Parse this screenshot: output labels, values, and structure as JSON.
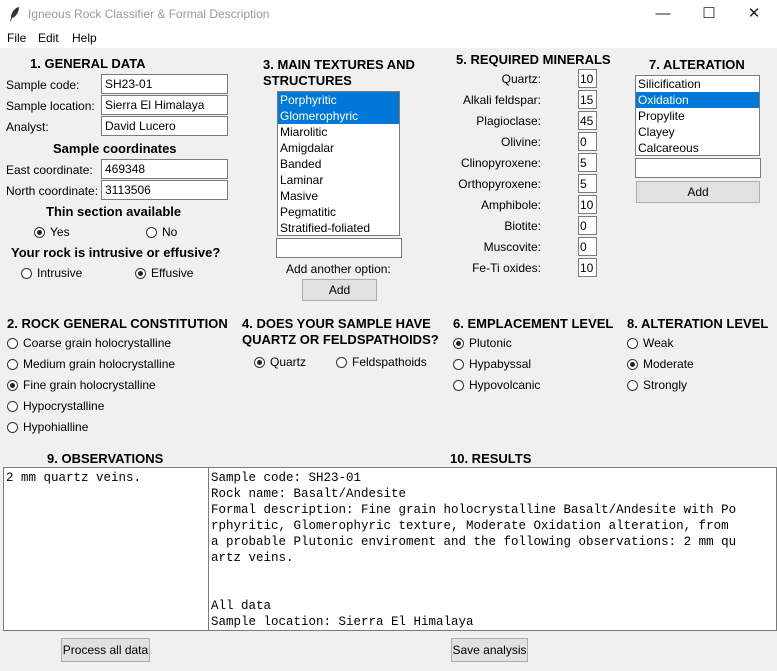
{
  "window": {
    "title": "Igneous Rock Classifier & Formal Description",
    "minimize": "—",
    "maximize": "☐",
    "close": "✕"
  },
  "menu": [
    "File",
    "Edit",
    "Help"
  ],
  "general": {
    "heading": "1. GENERAL DATA",
    "sample_code_label": "Sample code:",
    "sample_code": "SH23-01",
    "sample_location_label": "Sample location:",
    "sample_location": "Sierra El Himalaya",
    "analyst_label": "Analyst:",
    "analyst": "David Lucero",
    "coords_heading": "Sample coordinates",
    "east_label": "East coordinate:",
    "east": "469348",
    "north_label": "North coordinate:",
    "north": "3113506",
    "thin_heading": "Thin section available",
    "yes": "Yes",
    "no": "No",
    "thin_selected": "Yes",
    "intrusive_heading": "Your rock is intrusive or effusive?",
    "intrusive": "Intrusive",
    "effusive": "Effusive",
    "intrusive_selected": "Effusive"
  },
  "textures": {
    "heading_1": "3. MAIN TEXTURES AND",
    "heading_2": "STRUCTURES",
    "items": [
      "Porphyritic",
      "Glomerophyric",
      "Miarolitic",
      "Amigdalar",
      "Banded",
      "Laminar",
      "Masive",
      "Pegmatitic",
      "Stratified-foliated"
    ],
    "selected": [
      0,
      1
    ],
    "new_option": "",
    "add_another_label": "Add another option:",
    "add_button": "Add"
  },
  "minerals": {
    "heading": "5. REQUIRED MINERALS",
    "items": [
      {
        "name": "Quartz:",
        "value": "10"
      },
      {
        "name": "Alkali feldspar:",
        "value": "15"
      },
      {
        "name": "Plagioclase:",
        "value": "45"
      },
      {
        "name": "Olivine:",
        "value": "0"
      },
      {
        "name": "Clinopyroxene:",
        "value": "5"
      },
      {
        "name": "Orthopyroxene:",
        "value": "5"
      },
      {
        "name": "Amphibole:",
        "value": "10"
      },
      {
        "name": "Biotite:",
        "value": "0"
      },
      {
        "name": "Muscovite:",
        "value": "0"
      },
      {
        "name": "Fe-Ti oxides:",
        "value": "10"
      }
    ]
  },
  "alteration": {
    "heading": "7. ALTERATION",
    "items": [
      "Silicification",
      "Oxidation",
      "Propylite",
      "Clayey",
      "Calcareous"
    ],
    "selected": [
      1
    ],
    "new_option": "",
    "add_button": "Add"
  },
  "constitution": {
    "heading": "2. ROCK GENERAL CONSTITUTION",
    "options": [
      "Coarse grain holocrystalline",
      "Medium grain holocrystalline",
      "Fine grain holocrystalline",
      "Hypocrystalline",
      "Hypohialline"
    ],
    "selected": 2
  },
  "quartz_feld": {
    "heading_1": "4. DOES YOUR SAMPLE HAVE",
    "heading_2": "QUARTZ OR FELDSPATHOIDS?",
    "options": [
      "Quartz",
      "Feldspathoids"
    ],
    "selected": 0
  },
  "emplacement": {
    "heading": "6. EMPLACEMENT LEVEL",
    "options": [
      "Plutonic",
      "Hypabyssal",
      "Hypovolcanic"
    ],
    "selected": 0
  },
  "alteration_level": {
    "heading": "8. ALTERATION LEVEL",
    "options": [
      "Weak",
      "Moderate",
      "Strongly"
    ],
    "selected": 1
  },
  "observations": {
    "heading": "9. OBSERVATIONS",
    "lines": [
      "2 mm quartz veins."
    ]
  },
  "results": {
    "heading": "10. RESULTS",
    "lines": [
      "Sample code: SH23-01",
      "Rock name: Basalt/Andesite",
      "Formal description: Fine grain holocrystalline Basalt/Andesite with Po",
      "rphyritic, Glomerophyric texture, Moderate Oxidation alteration, from",
      "a probable Plutonic enviroment and the following observations: 2 mm qu",
      "artz veins.",
      "",
      "",
      "All data",
      "Sample location: Sierra El Himalaya"
    ]
  },
  "buttons": {
    "process": "Process all data",
    "save": "Save analysis"
  }
}
